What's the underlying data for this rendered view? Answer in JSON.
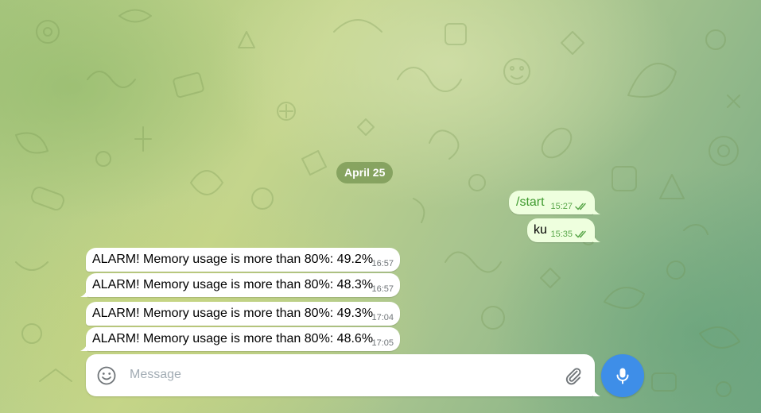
{
  "date_separator": "April 25",
  "colors": {
    "outgoing_bubble": "#eeffde",
    "incoming_bubble": "#ffffff",
    "accent_green": "#5ba84c",
    "mic_button": "#3e8ee8"
  },
  "outgoing_messages": [
    {
      "text": "/start",
      "time": "15:27",
      "status": "read",
      "status_icon": "double-check-icon"
    },
    {
      "text": "ku",
      "time": "15:35",
      "status": "read",
      "status_icon": "double-check-icon"
    }
  ],
  "incoming_messages": [
    {
      "text": "ALARM! Memory usage is more than 80%: 49.2%",
      "time": "16:57"
    },
    {
      "text": "ALARM! Memory usage is more than 80%: 48.3%",
      "time": "16:57"
    },
    {
      "text": "ALARM! Memory usage is more than 80%: 49.3%",
      "time": "17:04"
    },
    {
      "text": "ALARM! Memory usage is more than 80%: 48.6%",
      "time": "17:05"
    }
  ],
  "composer": {
    "placeholder": "Message",
    "value": "",
    "emoji_icon": "smiley-icon",
    "attach_icon": "paperclip-icon",
    "mic_icon": "microphone-icon"
  }
}
